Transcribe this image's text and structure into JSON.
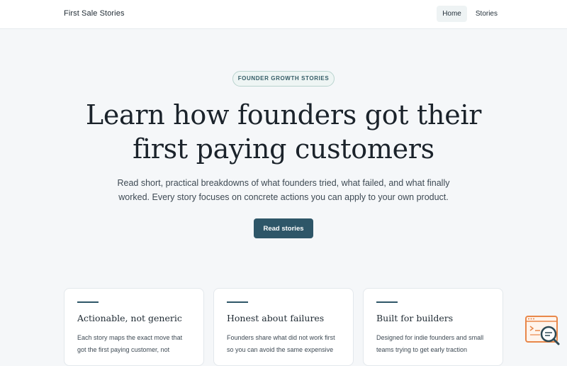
{
  "header": {
    "brand": "First Sale Stories",
    "nav": [
      {
        "label": "Home",
        "active": true
      },
      {
        "label": "Stories",
        "active": false
      }
    ]
  },
  "hero": {
    "eyebrow": "FOUNDER GROWTH STORIES",
    "title": "Learn how founders got their first paying customers",
    "subtitle": "Read short, practical breakdowns of what founders tried, what failed, and what finally worked. Every story focuses on concrete actions you can apply to your own product.",
    "cta": "Read stories"
  },
  "cards": [
    {
      "title": "Actionable, not generic",
      "text": "Each story maps the exact move that got the first paying customer, not"
    },
    {
      "title": "Honest about failures",
      "text": "Founders share what did not work first so you can avoid the same expensive"
    },
    {
      "title": "Built for builders",
      "text": "Designed for indie founders and small teams trying to get early traction"
    }
  ],
  "colors": {
    "accent": "#2e5668",
    "widget": "#e8874a",
    "background": "#f5f7f9"
  },
  "icons": {
    "help_widget": "search-chat-icon"
  }
}
